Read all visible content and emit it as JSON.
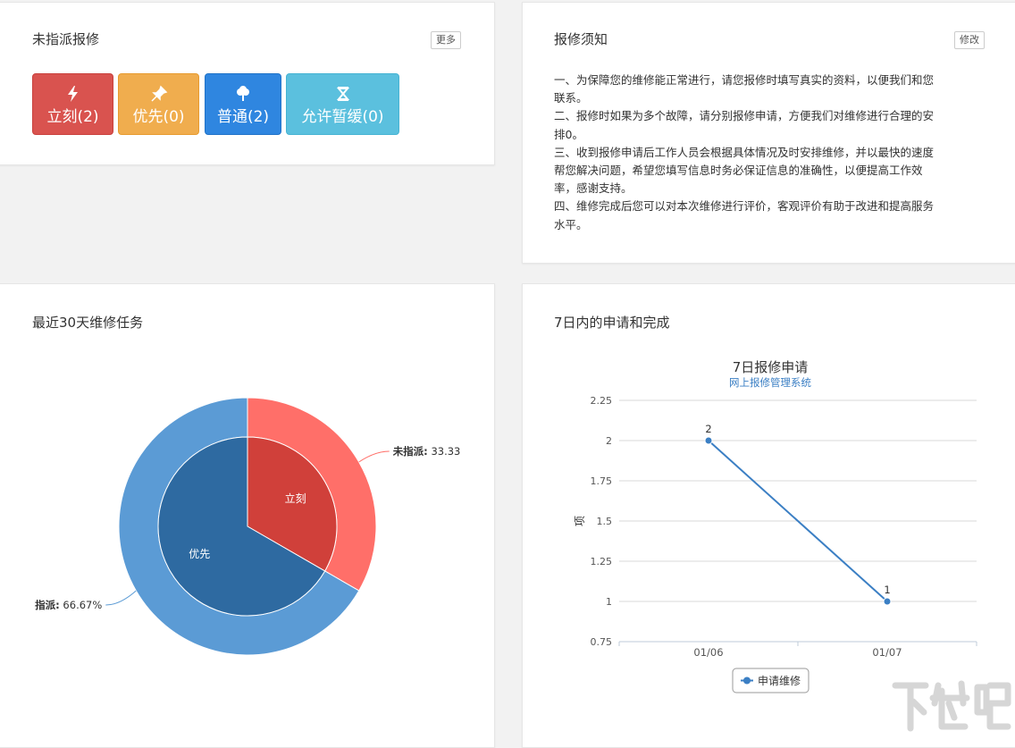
{
  "unassigned": {
    "title": "未指派报修",
    "more_label": "更多",
    "buttons": [
      {
        "label": "立刻(2)",
        "color": "#d9534f",
        "icon": "lightning-icon"
      },
      {
        "label": "优先(0)",
        "color": "#f0ad4e",
        "icon": "pin-icon"
      },
      {
        "label": "普通(2)",
        "color": "#2f86e0",
        "icon": "tree-icon"
      },
      {
        "label": "允许暂缓(0)",
        "color": "#5bc0de",
        "icon": "hourglass-icon"
      }
    ]
  },
  "notice": {
    "title": "报修须知",
    "edit_label": "修改",
    "lines": [
      "一、为保障您的维修能正常进行，请您报修时填写真实的资料，以便我们和您",
      "联系。",
      "二、报修时如果为多个故障，请分别报修申请，方便我们对维修进行合理的安",
      "排0。",
      "三、收到报修申请后工作人员会根据具体情况及时安排维修，并以最快的速度",
      "帮您解决问题，希望您填写信息时务必保证信息的准确性，以便提高工作效",
      "率，感谢支持。",
      "四、维修完成后您可以对本次维修进行评价，客观评价有助于改进和提高服务",
      "水平。"
    ]
  },
  "pie_panel": {
    "title": "最近30天维修任务"
  },
  "line_panel": {
    "title": "7日内的申请和完成"
  },
  "chart_data": [
    {
      "type": "pie",
      "outer": {
        "slices": [
          {
            "label": "未指派",
            "value": 33.33,
            "data_label": "未指派: 33.33",
            "color": "#ff6f69"
          },
          {
            "label": "",
            "value": 66.67,
            "data_label": "指派: 66.67%",
            "color": "#5b9bd5"
          }
        ]
      },
      "inner": {
        "slices": [
          {
            "label": "立刻",
            "value": 33.33,
            "color": "#d0403a"
          },
          {
            "label": "优先",
            "value": 66.67,
            "color": "#2e6aa1"
          }
        ]
      }
    },
    {
      "type": "line",
      "title": "7日报修申请",
      "subtitle": "网上报修管理系统",
      "ylabel": "项",
      "categories": [
        "01/06",
        "01/07"
      ],
      "series": [
        {
          "name": "申请维修",
          "values": [
            2,
            1
          ],
          "color": "#3b7fc4"
        }
      ],
      "ylim": [
        0.75,
        2.25
      ],
      "yticks": [
        "2.25",
        "2",
        "1.75",
        "1.5",
        "1.25",
        "1",
        "0.75"
      ],
      "data_labels": [
        "2",
        "1"
      ],
      "grid": true,
      "legend": "bottom"
    }
  ],
  "watermark": {
    "text": "下载吧"
  }
}
